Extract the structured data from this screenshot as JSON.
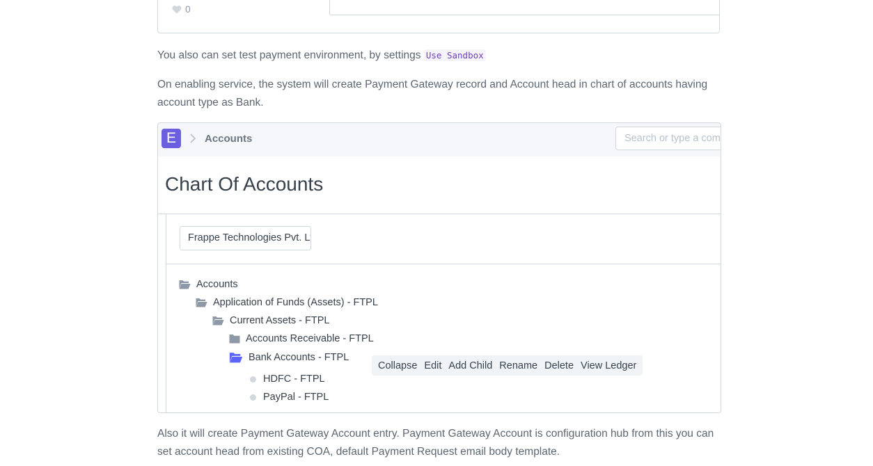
{
  "top_card": {
    "like_count": "0"
  },
  "paragraphs": {
    "sandbox_text": "You also can set test payment environment, by settings",
    "sandbox_code": "Use Sandbox",
    "enabling_text": "On enabling service, the system will create Payment Gateway record and Account head in chart of accounts having account type as Bank.",
    "gateway_text": "Also it will create Payment Gateway Account entry. Payment Gateway Account is configuration hub from this you can set account head from existing COA, default Payment Request email body template."
  },
  "screenshot": {
    "logo_letter": "E",
    "breadcrumb": "Accounts",
    "search_placeholder": "Search or type a command",
    "page_title": "Chart Of Accounts",
    "company_value": "Frappe Technologies Pvt. Ltd.",
    "tree": [
      {
        "label": "Accounts",
        "icon": "folder-open-icon",
        "depth": 0
      },
      {
        "label": "Application of Funds (Assets) - FTPL",
        "icon": "folder-open-icon",
        "depth": 1
      },
      {
        "label": "Current Assets - FTPL",
        "icon": "folder-open-icon",
        "depth": 2
      },
      {
        "label": "Accounts Receivable - FTPL",
        "icon": "folder-closed-icon",
        "depth": 3
      },
      {
        "label": "Bank Accounts - FTPL",
        "icon": "folder-open-icon",
        "depth": 3
      },
      {
        "label": "HDFC - FTPL",
        "icon": "leaf-dot-icon",
        "depth": 4
      },
      {
        "label": "PayPal - FTPL",
        "icon": "leaf-dot-icon",
        "depth": 4
      }
    ],
    "actions": [
      "Collapse",
      "Edit",
      "Add Child",
      "Rename",
      "Delete",
      "View Ledger"
    ]
  },
  "colors": {
    "accent": "#6b5fe0",
    "text_dark": "#36414c",
    "text_muted": "#5b6670",
    "border": "#d1d8dd",
    "code": "#6c3ec1"
  }
}
